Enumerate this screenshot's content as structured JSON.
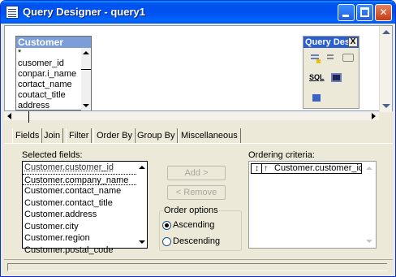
{
  "window": {
    "title": "Query Designer - query1"
  },
  "diagram": {
    "table": {
      "name": "Customer",
      "columns": [
        "*",
        "cusomer_id",
        "conpar.i_name",
        "cortact_name",
        "coutact_title",
        "address"
      ]
    },
    "toolbox": {
      "title": "Query Des",
      "close": "X",
      "sql_label": "SQL"
    }
  },
  "tabs": [
    "Fields",
    "Join",
    "Filter",
    "Order By",
    "Group By",
    "Miscellaneous"
  ],
  "order_by": {
    "selected_label": "Selected fields:",
    "selected_fields": [
      "Customer.customer_id",
      "Customer.company_name",
      "Customer.contact_name",
      "Customer.contact_title",
      "Customer.address",
      "Customer.city",
      "Customer.region",
      "Customer.postal_code"
    ],
    "add_button": "Add >",
    "remove_button": "< Remove",
    "order_options_label": "Order options",
    "ascending_label": "Ascending",
    "descending_label": "Descending",
    "ascending_selected": true,
    "criteria_label": "Ordering criteria:",
    "criteria": [
      {
        "handle": "↕",
        "direction": "↑",
        "field": "Customer.customer_ic"
      }
    ]
  }
}
